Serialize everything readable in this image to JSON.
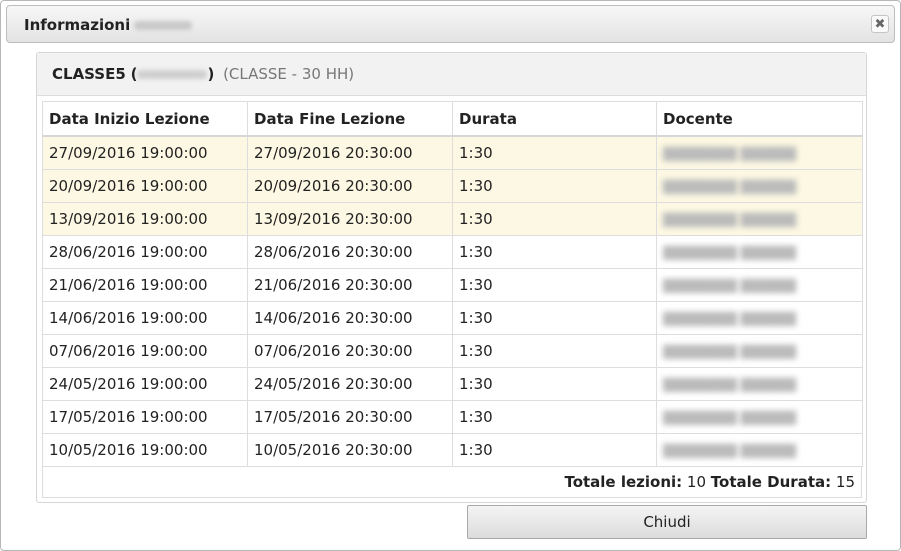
{
  "dialog": {
    "title": "Informazioni",
    "close_glyph": "✖",
    "close_icon": "close-icon"
  },
  "panel": {
    "class_name": "CLASSE5",
    "open_paren": "(",
    "close_paren": ")",
    "subtitle": "(CLASSE - 30 HH)"
  },
  "table": {
    "headers": [
      "Data Inizio Lezione",
      "Data Fine Lezione",
      "Durata",
      "Docente"
    ],
    "rows": [
      {
        "start": "27/09/2016 19:00:00",
        "end": "27/09/2016 20:30:00",
        "duration": "1:30",
        "highlight": true
      },
      {
        "start": "20/09/2016 19:00:00",
        "end": "20/09/2016 20:30:00",
        "duration": "1:30",
        "highlight": true
      },
      {
        "start": "13/09/2016 19:00:00",
        "end": "13/09/2016 20:30:00",
        "duration": "1:30",
        "highlight": true
      },
      {
        "start": "28/06/2016 19:00:00",
        "end": "28/06/2016 20:30:00",
        "duration": "1:30",
        "highlight": false
      },
      {
        "start": "21/06/2016 19:00:00",
        "end": "21/06/2016 20:30:00",
        "duration": "1:30",
        "highlight": false
      },
      {
        "start": "14/06/2016 19:00:00",
        "end": "14/06/2016 20:30:00",
        "duration": "1:30",
        "highlight": false
      },
      {
        "start": "07/06/2016 19:00:00",
        "end": "07/06/2016 20:30:00",
        "duration": "1:30",
        "highlight": false
      },
      {
        "start": "24/05/2016 19:00:00",
        "end": "24/05/2016 20:30:00",
        "duration": "1:30",
        "highlight": false
      },
      {
        "start": "17/05/2016 19:00:00",
        "end": "17/05/2016 20:30:00",
        "duration": "1:30",
        "highlight": false
      },
      {
        "start": "10/05/2016 19:00:00",
        "end": "10/05/2016 20:30:00",
        "duration": "1:30",
        "highlight": false
      }
    ],
    "highlight_color": "#fcf8e3"
  },
  "footer": {
    "total_lessons_label": "Totale lezioni:",
    "total_lessons_value": "10",
    "total_duration_label": "Totale Durata:",
    "total_duration_value": "15"
  },
  "close_button": {
    "label": "Chiudi"
  }
}
